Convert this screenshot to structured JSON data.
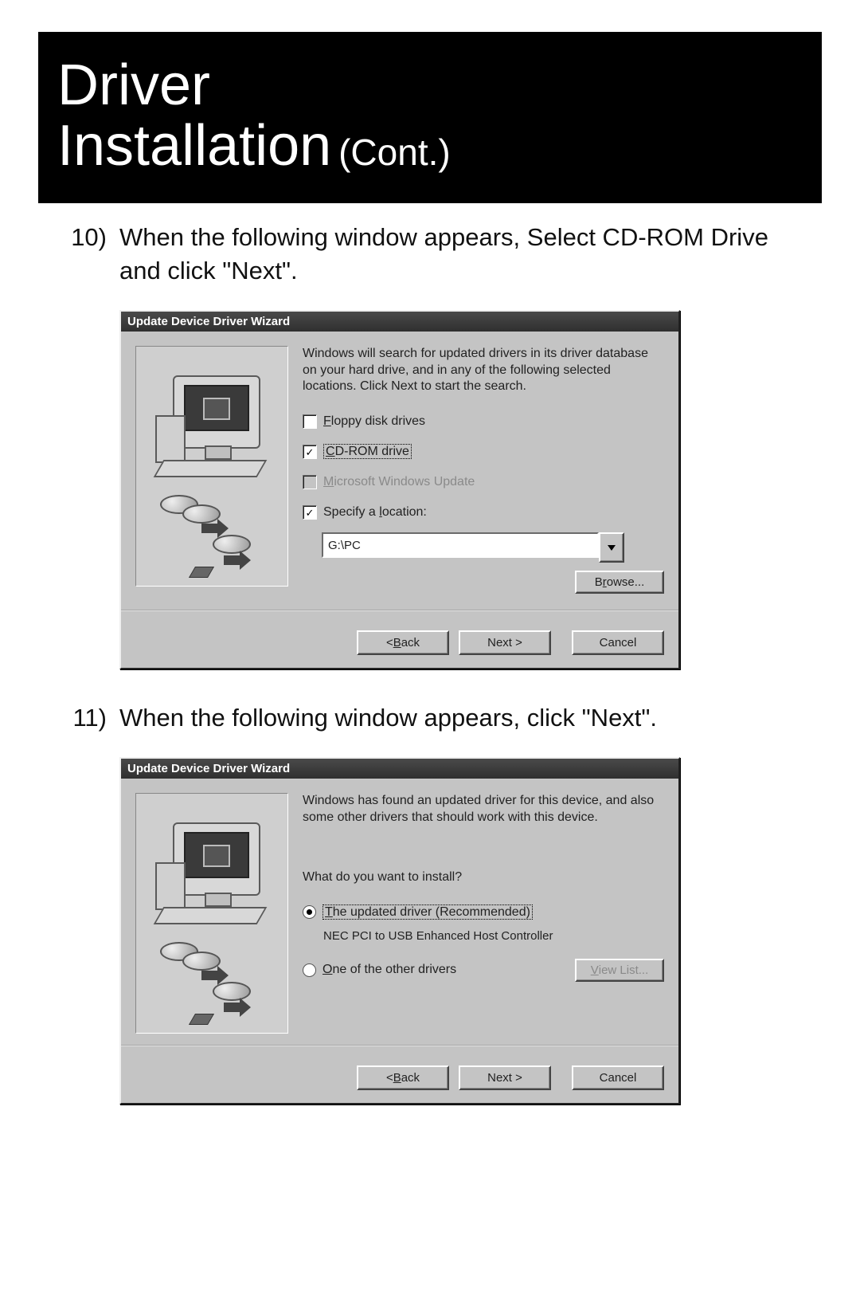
{
  "banner": {
    "title_line1": "Driver",
    "title_line2": "Installation",
    "suffix": "(Cont.)"
  },
  "steps": {
    "s10": {
      "num": "10)",
      "text": "When the following window appears, Select CD-ROM Drive and click \"Next\"."
    },
    "s11": {
      "num": "11)",
      "text": "When the following window appears, click \"Next\"."
    }
  },
  "dlg1": {
    "title": "Update Device Driver Wizard",
    "intro": "Windows will search for updated drivers in its driver database on your hard drive, and in any of the following selected locations. Click Next to start the search.",
    "floppy_mn": "F",
    "floppy_rest": "loppy disk drives",
    "cdrom_mn": "C",
    "cdrom_rest": "D-ROM drive",
    "msupdate_mn": "M",
    "msupdate_rest": "icrosoft Windows Update",
    "specify_pre": "Specify a ",
    "specify_mn": "l",
    "specify_post": "ocation:",
    "location_value": "G:\\PC",
    "browse_pre": "B",
    "browse_mn": "r",
    "browse_post": "owse...",
    "back_pre": "< ",
    "back_mn": "B",
    "back_post": "ack",
    "next": "Next >",
    "cancel": "Cancel"
  },
  "dlg2": {
    "title": "Update Device Driver Wizard",
    "intro": "Windows has found an updated driver for this device, and also some other drivers that should work with this device.",
    "question": "What do you want to install?",
    "opt1_mn": "T",
    "opt1_rest": "he updated driver (Recommended)",
    "opt1_desc": "NEC PCI to USB Enhanced Host Controller",
    "opt2_mn": "O",
    "opt2_rest": "ne of the other drivers",
    "viewlist_mn": "V",
    "viewlist_rest": "iew List...",
    "back_pre": "< ",
    "back_mn": "B",
    "back_post": "ack",
    "next": "Next >",
    "cancel": "Cancel"
  }
}
